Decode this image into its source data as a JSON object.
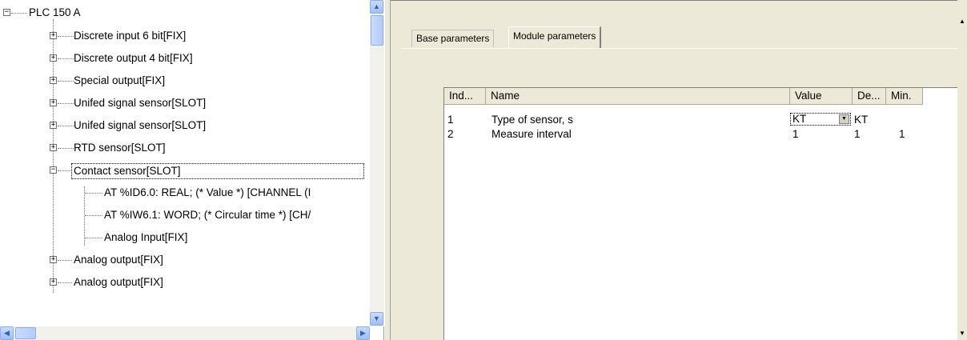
{
  "tree": {
    "root": "PLC 150 A",
    "items": [
      {
        "label": "Discrete input 6 bit[FIX]"
      },
      {
        "label": "Discrete output 4 bit[FIX]"
      },
      {
        "label": "Special output[FIX]"
      },
      {
        "label": "Unifed signal sensor[SLOT]"
      },
      {
        "label": "Unifed signal sensor[SLOT]"
      },
      {
        "label": "RTD sensor[SLOT]"
      },
      {
        "label": "Contact sensor[SLOT]"
      },
      {
        "label": "AT %ID6.0: REAL; (* Value *) [CHANNEL (I"
      },
      {
        "label": "AT %IW6.1: WORD; (* Circular time *) [CH/"
      },
      {
        "label": "Analog Input[FIX]"
      },
      {
        "label": "Analog output[FIX]"
      },
      {
        "label": "Analog output[FIX]"
      }
    ]
  },
  "tabs": {
    "base": "Base parameters",
    "module": "Module parameters"
  },
  "grid": {
    "headers": [
      "Ind...",
      "Name",
      "Value",
      "De...",
      "Min."
    ],
    "rows": [
      {
        "index": "1",
        "name": "Type of sensor, s",
        "value": "KT",
        "default": "KT",
        "min": ""
      },
      {
        "index": "2",
        "name": "Measure interval",
        "value": "1",
        "default": "1",
        "min": "1"
      }
    ]
  },
  "icons": {
    "expanded": "minus-box-icon",
    "collapsed": "plus-box-icon",
    "scroll_up": "arrow-up-icon",
    "scroll_down": "arrow-down-icon",
    "scroll_left": "arrow-left-icon",
    "scroll_right": "arrow-right-icon",
    "combo": "chevron-down-icon"
  },
  "colors": {
    "pane_bg": "#ece9d8",
    "scroll_accent": "#9fbff5"
  }
}
